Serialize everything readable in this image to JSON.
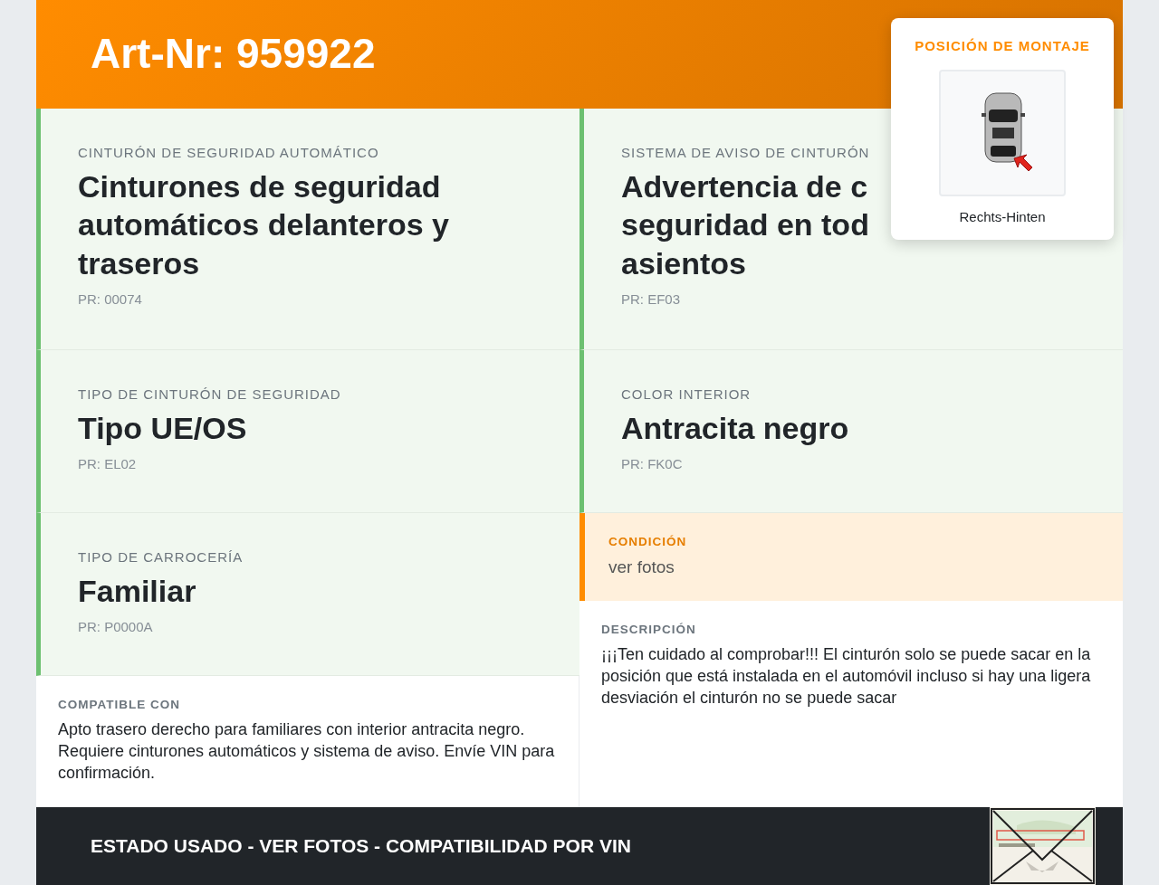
{
  "header": {
    "title": "Art-Nr: 959922"
  },
  "mounting_position": {
    "title": "POSICIÓN DE MONTAJE",
    "caption": "Rechts-Hinten"
  },
  "left_column": {
    "specs": [
      {
        "label": "CINTURÓN DE SEGURIDAD AUTOMÁTICO",
        "title": "Cinturones de seguridad automáticos delanteros y traseros",
        "code": "PR: 00074"
      },
      {
        "label": "TIPO DE CINTURÓN DE SEGURIDAD",
        "title": "Tipo UE/OS",
        "code": "PR: EL02"
      },
      {
        "label": "TIPO DE CARROCERÍA",
        "title": "Familiar",
        "code": "PR: P0000A"
      }
    ],
    "compatible": {
      "label": "COMPATIBLE CON",
      "text": "Apto trasero derecho para familiares con interior antracita negro. Requiere cinturones automáticos y sistema de aviso. Envíe VIN para confirmación."
    }
  },
  "right_column": {
    "specs": [
      {
        "label": "SISTEMA DE AVISO DE CINTURÓN",
        "title_lines": [
          "Advertencia de c",
          "seguridad en tod",
          "asientos"
        ],
        "code": "PR: EF03"
      },
      {
        "label": "COLOR INTERIOR",
        "title": "Antracita negro",
        "code": "PR: FK0C"
      }
    ],
    "condition": {
      "label": "CONDICIÓN",
      "value": "ver fotos"
    },
    "description": {
      "label": "DESCRIPCIÓN",
      "text": "¡¡¡Ten cuidado al comprobar!!! El cinturón solo se puede sacar en la posición que está instalada en el automóvil incluso si hay una ligera desviación el cinturón no se puede sacar"
    }
  },
  "footer": {
    "text": "ESTADO USADO - VER FOTOS - COMPATIBILIDAD POR VIN"
  }
}
